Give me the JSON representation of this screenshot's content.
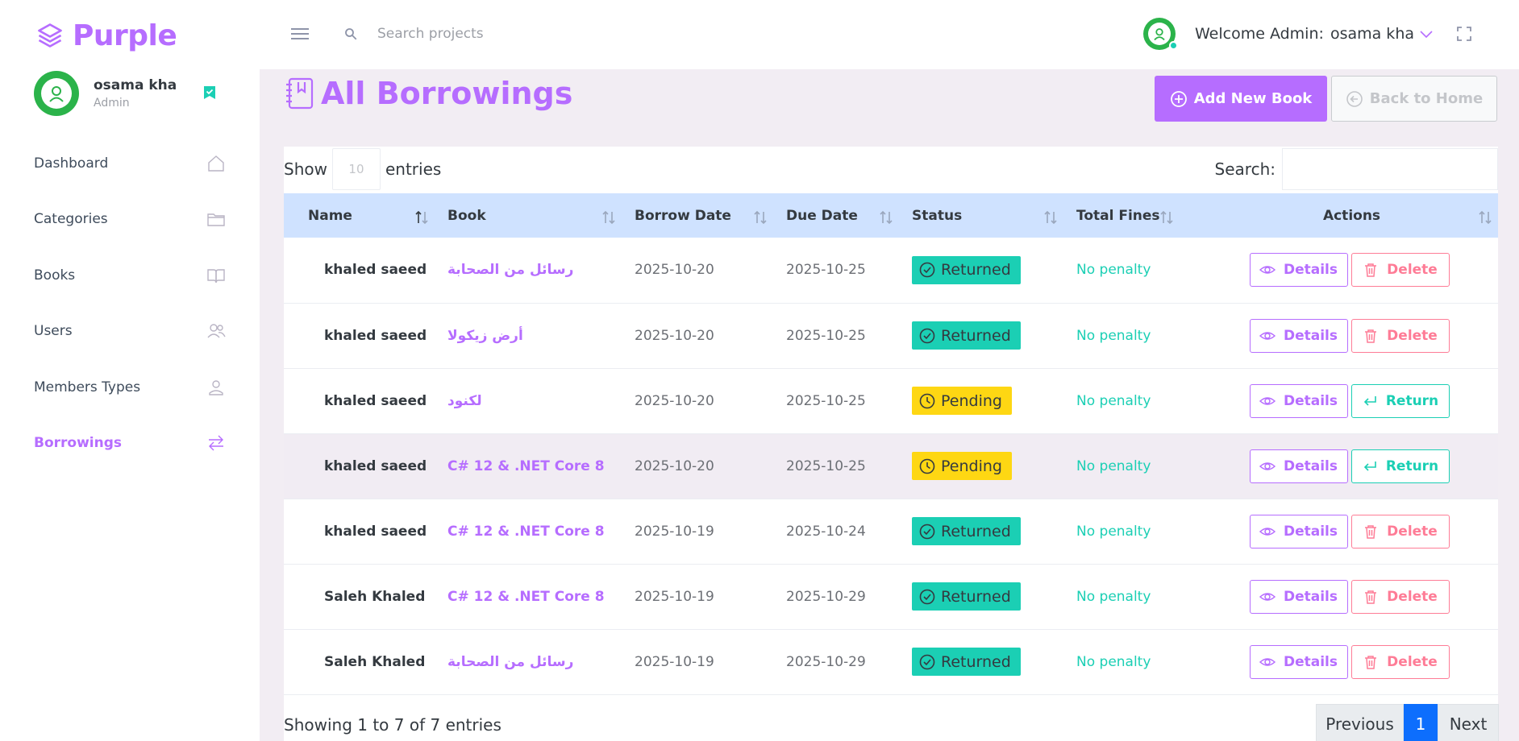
{
  "sidebar": {
    "brand": "Purple",
    "profile": {
      "name": "osama kha",
      "role": "Admin"
    },
    "items": [
      {
        "label": "Dashboard",
        "icon": "home-icon"
      },
      {
        "label": "Categories",
        "icon": "folder-icon"
      },
      {
        "label": "Books",
        "icon": "book-open-icon"
      },
      {
        "label": "Users",
        "icon": "users-icon"
      },
      {
        "label": "Members Types",
        "icon": "user-icon"
      },
      {
        "label": "Borrowings",
        "icon": "swap-icon",
        "active": true
      }
    ]
  },
  "navbar": {
    "search_placeholder": "Search projects",
    "welcome_prefix": "Welcome Admin:",
    "welcome_user": "osama kha"
  },
  "page": {
    "title": "All Borrowings",
    "add_button": "Add New Book",
    "back_button": "Back to Home"
  },
  "table": {
    "show_label": "Show",
    "page_length": "10",
    "entries_label": "entries",
    "search_label": "Search:",
    "columns": [
      "Name",
      "Book",
      "Borrow Date",
      "Due Date",
      "Status",
      "Total Fines",
      "Actions"
    ],
    "rows": [
      {
        "name": "khaled saeed",
        "book": "رسائل من الصحابة",
        "borrow_date": "2025-10-20",
        "due_date": "2025-10-25",
        "status": "Returned",
        "fines": "No penalty",
        "action2": "Delete"
      },
      {
        "name": "khaled saeed",
        "book": "أرض زيكولا",
        "borrow_date": "2025-10-20",
        "due_date": "2025-10-25",
        "status": "Returned",
        "fines": "No penalty",
        "action2": "Delete"
      },
      {
        "name": "khaled saeed",
        "book": "لكنود",
        "borrow_date": "2025-10-20",
        "due_date": "2025-10-25",
        "status": "Pending",
        "fines": "No penalty",
        "action2": "Return"
      },
      {
        "name": "khaled saeed",
        "book": "C# 12 & .NET Core 8",
        "borrow_date": "2025-10-20",
        "due_date": "2025-10-25",
        "status": "Pending",
        "fines": "No penalty",
        "action2": "Return"
      },
      {
        "name": "khaled saeed",
        "book": "C# 12 & .NET Core 8",
        "borrow_date": "2025-10-19",
        "due_date": "2025-10-24",
        "status": "Returned",
        "fines": "No penalty",
        "action2": "Delete"
      },
      {
        "name": "Saleh Khaled",
        "book": "C# 12 & .NET Core 8",
        "borrow_date": "2025-10-19",
        "due_date": "2025-10-29",
        "status": "Returned",
        "fines": "No penalty",
        "action2": "Delete"
      },
      {
        "name": "Saleh Khaled",
        "book": "رسائل من الصحابة",
        "borrow_date": "2025-10-19",
        "due_date": "2025-10-29",
        "status": "Returned",
        "fines": "No penalty",
        "action2": "Delete"
      }
    ],
    "details_label": "Details",
    "info": "Showing 1 to 7 of 7 entries",
    "pager": {
      "previous": "Previous",
      "current": "1",
      "next": "Next"
    }
  },
  "colors": {
    "primary": "#b66dff",
    "success": "#1bcfb4",
    "warning": "#fed713",
    "danger": "#fe7c96",
    "header_row": "#cfe2ff",
    "pager_active": "#0d6efd"
  }
}
